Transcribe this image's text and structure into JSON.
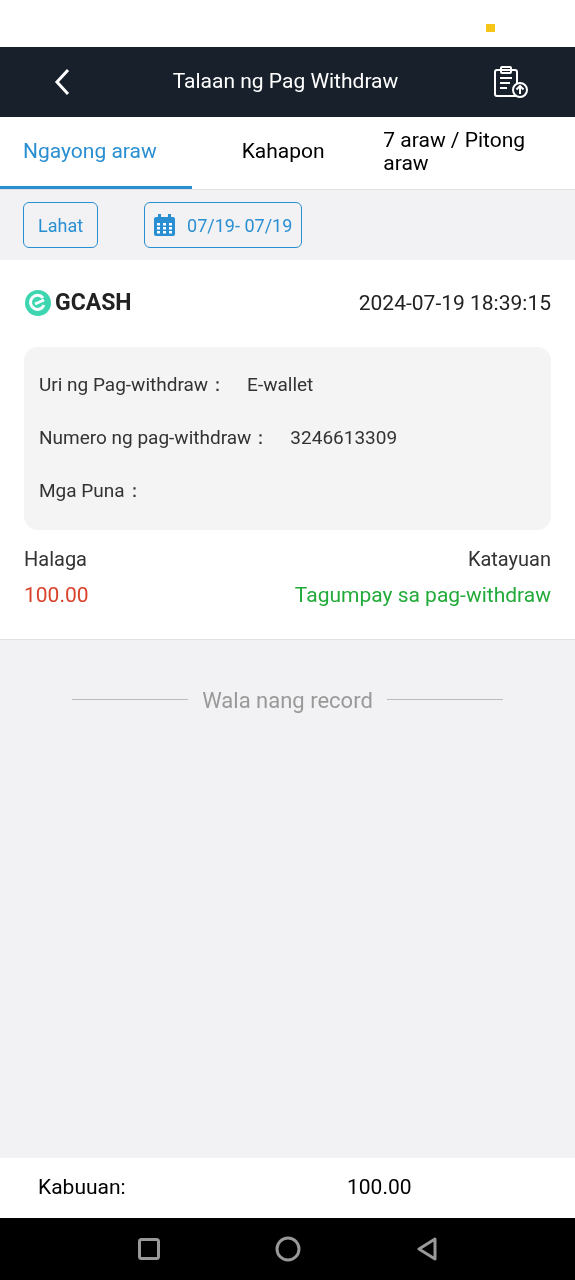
{
  "header": {
    "title": "Talaan ng Pag Withdraw"
  },
  "tabs": [
    {
      "label": "Ngayong araw",
      "selected": true
    },
    {
      "label": "Kahapon",
      "selected": false
    },
    {
      "label": "7 araw / Pitong araw",
      "selected": false
    }
  ],
  "filters": {
    "all_button": "Lahat",
    "date_range": "07/19- 07/19"
  },
  "records": [
    {
      "method": "GCASH",
      "time": "2024-07-19 18:39:15",
      "details": [
        {
          "label": "Uri ng Pag-withdraw：",
          "value": "E-wallet"
        },
        {
          "label": "Numero ng pag-withdraw：",
          "value": "3246613309"
        },
        {
          "label": "Mga Puna："
        }
      ],
      "amount_label": "Halaga",
      "amount": "100.00",
      "status_label": "Katayuan",
      "status": {
        "text": "Tagumpay sa pag-withdraw",
        "kind": "success"
      }
    }
  ],
  "end_note": "Wala nang record",
  "footer": {
    "label": "Kabuuan:",
    "value": "100.00"
  }
}
